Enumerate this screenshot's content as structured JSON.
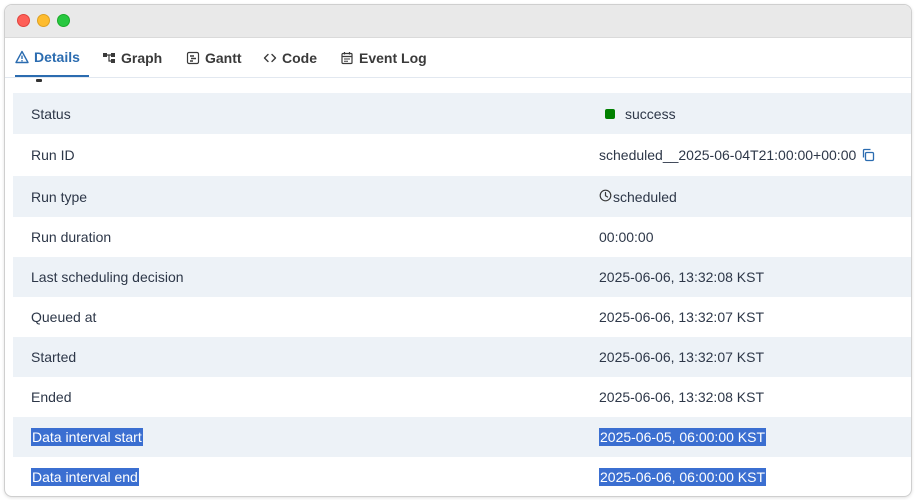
{
  "colors": {
    "accent": "#2b6cb0",
    "row_alt": "#edf2f7",
    "success": "#008000",
    "selection": "#3b6fd1"
  },
  "tabs": [
    {
      "label": "Details",
      "icon": "warning-triangle-icon",
      "active": true
    },
    {
      "label": "Graph",
      "icon": "graph-icon",
      "active": false
    },
    {
      "label": "Gantt",
      "icon": "gantt-icon",
      "active": false
    },
    {
      "label": "Code",
      "icon": "code-icon",
      "active": false
    },
    {
      "label": "Event Log",
      "icon": "calendar-icon",
      "active": false
    }
  ],
  "details": {
    "status": {
      "label": "Status",
      "value": "success"
    },
    "run_id": {
      "label": "Run ID",
      "value": "scheduled__2025-06-04T21:00:00+00:00"
    },
    "run_type": {
      "label": "Run type",
      "value": "scheduled"
    },
    "run_duration": {
      "label": "Run duration",
      "value": "00:00:00"
    },
    "last_scheduling_decision": {
      "label": "Last scheduling decision",
      "value": "2025-06-06, 13:32:08 KST"
    },
    "queued_at": {
      "label": "Queued at",
      "value": "2025-06-06, 13:32:07 KST"
    },
    "started": {
      "label": "Started",
      "value": "2025-06-06, 13:32:07 KST"
    },
    "ended": {
      "label": "Ended",
      "value": "2025-06-06, 13:32:08 KST"
    },
    "data_interval_start": {
      "label": "Data interval start",
      "value": "2025-06-05, 06:00:00 KST"
    },
    "data_interval_end": {
      "label": "Data interval end",
      "value": "2025-06-06, 06:00:00 KST"
    }
  }
}
